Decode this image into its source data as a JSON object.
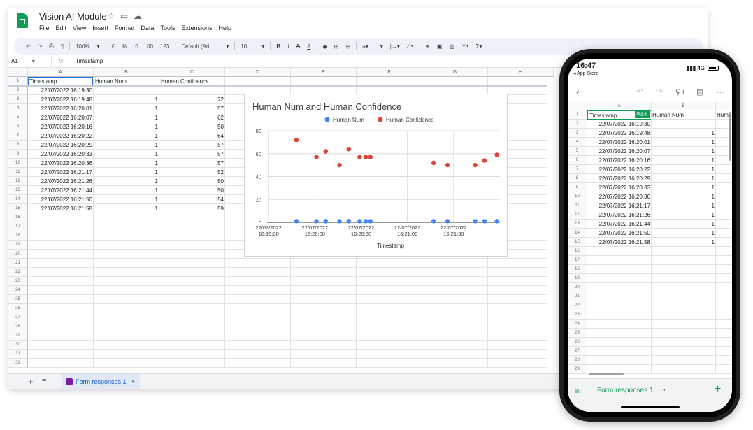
{
  "app": {
    "title": "Vision AI Module",
    "menu": [
      "File",
      "Edit",
      "View",
      "Insert",
      "Format",
      "Data",
      "Tools",
      "Extensions",
      "Help"
    ],
    "toolbar": {
      "zoom": "100%",
      "currency": "£",
      "percent": "%",
      "dec_less": ".0",
      "dec_more": ".00",
      "format_123": "123",
      "font": "Default (Ari...",
      "font_size": "10"
    },
    "formula_bar": {
      "cell_ref": "A1",
      "fx": "fx",
      "content": "Timestamp"
    },
    "columns": [
      "A",
      "B",
      "C",
      "D",
      "E",
      "F",
      "G",
      "H"
    ],
    "headers": [
      "Timestamp",
      "Human Num",
      "Human Confidence"
    ],
    "rows": [
      {
        "n": "1"
      },
      {
        "n": "2",
        "ts": "22/07/2022 16:19:30",
        "num": "",
        "conf": ""
      },
      {
        "n": "3",
        "ts": "22/07/2022 16:19:48",
        "num": "1",
        "conf": "72"
      },
      {
        "n": "4",
        "ts": "22/07/2022 16:20:01",
        "num": "1",
        "conf": "57"
      },
      {
        "n": "5",
        "ts": "22/07/2022 16:20:07",
        "num": "1",
        "conf": "62"
      },
      {
        "n": "6",
        "ts": "22/07/2022 16:20:16",
        "num": "1",
        "conf": "50"
      },
      {
        "n": "7",
        "ts": "22/07/2022 16:20:22",
        "num": "1",
        "conf": "64"
      },
      {
        "n": "8",
        "ts": "22/07/2022 16:20:29",
        "num": "1",
        "conf": "57"
      },
      {
        "n": "9",
        "ts": "22/07/2022 16:20:33",
        "num": "1",
        "conf": "57"
      },
      {
        "n": "10",
        "ts": "22/07/2022 16:20:36",
        "num": "1",
        "conf": "57"
      },
      {
        "n": "11",
        "ts": "22/07/2022 16:21:17",
        "num": "1",
        "conf": "52"
      },
      {
        "n": "12",
        "ts": "22/07/2022 16:21:26",
        "num": "1",
        "conf": "50"
      },
      {
        "n": "13",
        "ts": "22/07/2022 16:21:44",
        "num": "1",
        "conf": "50"
      },
      {
        "n": "14",
        "ts": "22/07/2022 16:21:50",
        "num": "1",
        "conf": "54"
      },
      {
        "n": "15",
        "ts": "22/07/2022 16:21:58",
        "num": "1",
        "conf": "59"
      },
      {
        "n": "16"
      },
      {
        "n": "17"
      },
      {
        "n": "18"
      },
      {
        "n": "19"
      },
      {
        "n": "20"
      },
      {
        "n": "21"
      },
      {
        "n": "22"
      },
      {
        "n": "23"
      },
      {
        "n": "24"
      },
      {
        "n": "25"
      },
      {
        "n": "26"
      },
      {
        "n": "27"
      },
      {
        "n": "28"
      },
      {
        "n": "29"
      },
      {
        "n": "30"
      },
      {
        "n": "31"
      },
      {
        "n": "32"
      }
    ],
    "sheet_tab": "Form responses 1"
  },
  "chart_data": {
    "type": "scatter",
    "title": "Human Num and Human Confidence",
    "xlabel": "Timestamp",
    "ylabel": "",
    "ylim": [
      0,
      80
    ],
    "yticks": [
      "0",
      "20",
      "40",
      "60",
      "80"
    ],
    "xticks": [
      {
        "line1": "22/07/2022",
        "line2": "16:19:30",
        "t": 0
      },
      {
        "line1": "22/07/2022",
        "line2": "16:20:00",
        "t": 30
      },
      {
        "line1": "22/07/2022",
        "line2": "16:20:30",
        "t": 60
      },
      {
        "line1": "22/07/2022",
        "line2": "16:21:00",
        "t": 90
      },
      {
        "line1": "22/07/2022",
        "line2": "16:21:30",
        "t": 120
      }
    ],
    "legend_position": "top",
    "x_seconds": [
      18,
      31,
      37,
      46,
      52,
      59,
      63,
      66,
      107,
      116,
      134,
      140,
      148
    ],
    "series": [
      {
        "name": "Human Num",
        "color": "#4285f4",
        "values": [
          1,
          1,
          1,
          1,
          1,
          1,
          1,
          1,
          1,
          1,
          1,
          1,
          1
        ]
      },
      {
        "name": "Human Confidence",
        "color": "#db4437",
        "values": [
          72,
          57,
          62,
          50,
          64,
          57,
          57,
          57,
          52,
          50,
          50,
          54,
          59
        ]
      }
    ]
  },
  "phone": {
    "time": "16:47",
    "back_label": "◂ App Store",
    "signal": "4G",
    "columns": [
      "A",
      "B"
    ],
    "col_c_partial": "Huma",
    "badge": "黎孟俊",
    "row_numbers": [
      "1",
      "2",
      "3",
      "4",
      "5",
      "6",
      "7",
      "8",
      "9",
      "10",
      "11",
      "12",
      "13",
      "14",
      "15",
      "16",
      "17",
      "18",
      "19",
      "20",
      "21",
      "22",
      "23",
      "24",
      "25",
      "26",
      "27",
      "28",
      "29"
    ],
    "sheet_tab": "Form responses 1"
  },
  "colors": {
    "green": "#0f9d58",
    "selection": "#1a73e8",
    "toolbar_bg": "#edf2fa"
  }
}
